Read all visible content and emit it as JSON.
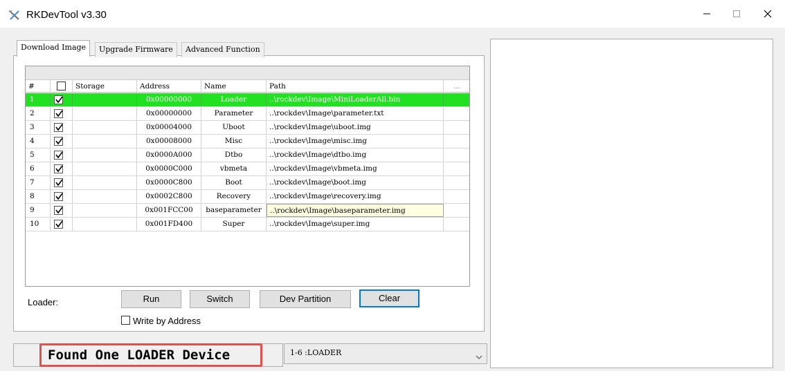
{
  "window": {
    "title": "RKDevTool v3.30",
    "minimize_icon": "minimize-icon",
    "maximize_icon": "maximize-icon",
    "close_icon": "close-icon"
  },
  "tabs": [
    {
      "label": "Download Image",
      "active": true
    },
    {
      "label": "Upgrade Firmware",
      "active": false
    },
    {
      "label": "Advanced Function",
      "active": false
    }
  ],
  "table": {
    "columns": [
      "#",
      "",
      "Storage",
      "Address",
      "Name",
      "Path",
      "..."
    ],
    "rows": [
      {
        "num": "1",
        "checked": true,
        "storage": "",
        "address": "0x00000000",
        "name": "Loader",
        "path": "..\\rockdev\\Image\\MiniLoaderAll.bin"
      },
      {
        "num": "2",
        "checked": true,
        "storage": "",
        "address": "0x00000000",
        "name": "Parameter",
        "path": "..\\rockdev\\Image\\parameter.txt"
      },
      {
        "num": "3",
        "checked": true,
        "storage": "",
        "address": "0x00004000",
        "name": "Uboot",
        "path": "..\\rockdev\\Image\\uboot.img"
      },
      {
        "num": "4",
        "checked": true,
        "storage": "",
        "address": "0x00008000",
        "name": "Misc",
        "path": "..\\rockdev\\Image\\misc.img"
      },
      {
        "num": "5",
        "checked": true,
        "storage": "",
        "address": "0x0000A000",
        "name": "Dtbo",
        "path": "..\\rockdev\\Image\\dtbo.img"
      },
      {
        "num": "6",
        "checked": true,
        "storage": "",
        "address": "0x0000C000",
        "name": "vbmeta",
        "path": "..\\rockdev\\Image\\vbmeta.img"
      },
      {
        "num": "7",
        "checked": true,
        "storage": "",
        "address": "0x0000C800",
        "name": "Boot",
        "path": "..\\rockdev\\Image\\boot.img"
      },
      {
        "num": "8",
        "checked": true,
        "storage": "",
        "address": "0x0002C800",
        "name": "Recovery",
        "path": "..\\rockdev\\Image\\recovery.img"
      },
      {
        "num": "9",
        "checked": true,
        "storage": "",
        "address": "0x001FCC00",
        "name": "baseparameter",
        "path": "..\\rockdev\\Image\\baseparameter.img"
      },
      {
        "num": "10",
        "checked": true,
        "storage": "",
        "address": "0x001FD400",
        "name": "Super",
        "path": "..\\rockdev\\Image\\super.img"
      }
    ],
    "highlight_color": "#22e022"
  },
  "controls": {
    "loader_label": "Loader:",
    "run_label": "Run",
    "switch_label": "Switch",
    "dev_partition_label": "Dev Partition",
    "clear_label": "Clear",
    "write_by_address_label": "Write by Address",
    "write_by_address_checked": false
  },
  "status": {
    "message": "Found One LOADER Device",
    "highlight_border_color": "#e0504c"
  },
  "device_select": {
    "value": "1-6 :LOADER"
  }
}
